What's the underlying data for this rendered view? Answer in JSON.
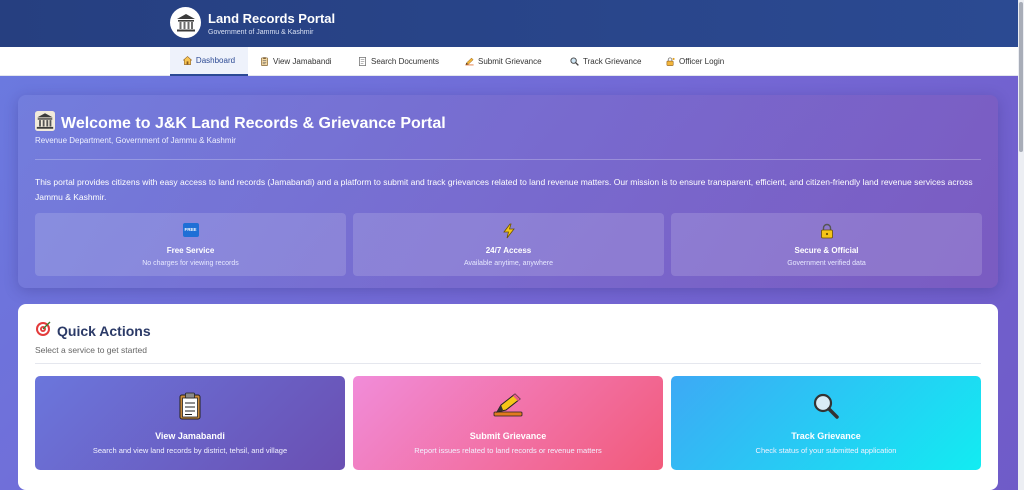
{
  "header": {
    "title": "Land Records Portal",
    "subtitle": "Government of Jammu & Kashmir",
    "logo_icon": "government-building-icon"
  },
  "nav": {
    "items": [
      {
        "label": "Dashboard",
        "icon": "home-icon",
        "active": true
      },
      {
        "label": "View Jamabandi",
        "icon": "clipboard-icon"
      },
      {
        "label": "Search Documents",
        "icon": "document-icon"
      },
      {
        "label": "Submit Grievance",
        "icon": "pencil-icon"
      },
      {
        "label": "Track Grievance",
        "icon": "search-icon"
      },
      {
        "label": "Officer Login",
        "icon": "lock-key-icon"
      }
    ]
  },
  "welcome": {
    "title": "Welcome to J&K Land Records & Grievance Portal",
    "subtitle": "Revenue Department, Government of Jammu & Kashmir",
    "description": "This portal provides citizens with easy access to land records (Jamabandi) and a platform to submit and track grievances related to land revenue matters. Our mission is to ensure transparent, efficient, and citizen-friendly land revenue services across Jammu & Kashmir.",
    "features": [
      {
        "icon": "free-badge-icon",
        "badge": "FREE",
        "title": "Free Service",
        "desc": "No charges for viewing records"
      },
      {
        "icon": "lightning-icon",
        "title": "24/7 Access",
        "desc": "Available anytime, anywhere"
      },
      {
        "icon": "lock-icon",
        "title": "Secure & Official",
        "desc": "Government verified data"
      }
    ]
  },
  "quick_actions": {
    "title": "Quick Actions",
    "subtitle": "Select a service to get started",
    "cards": [
      {
        "icon": "clipboard-icon",
        "title": "View Jamabandi",
        "desc": "Search and view land records by district, tehsil, and village"
      },
      {
        "icon": "pencil-icon",
        "title": "Submit Grievance",
        "desc": "Report issues related to land records or revenue matters"
      },
      {
        "icon": "magnifier-icon",
        "title": "Track Grievance",
        "desc": "Check status of your submitted application"
      }
    ]
  },
  "colors": {
    "header": "#2b4a92",
    "card_jamabandi": "#6a5acd",
    "card_grievance": "#f06a8a",
    "card_track": "#22c8f0"
  }
}
